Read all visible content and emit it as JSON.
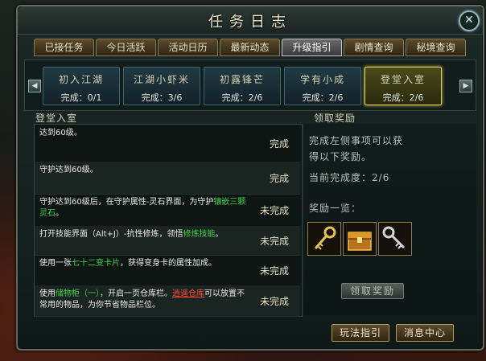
{
  "window": {
    "title": "任务日志",
    "close": "✕"
  },
  "tabs": [
    "已接任务",
    "今日活跃",
    "活动日历",
    "最新动态",
    "升级指引",
    "剧情查询",
    "秘境查询"
  ],
  "active_tab_index": 4,
  "stages": [
    {
      "name": "初入江湖",
      "progress": "完成：0/1"
    },
    {
      "name": "江湖小虾米",
      "progress": "完成：3/6"
    },
    {
      "name": "初露锋芒",
      "progress": "完成：2/6"
    },
    {
      "name": "学有小成",
      "progress": "完成：2/6"
    },
    {
      "name": "登堂入室",
      "progress": "完成：2/6"
    }
  ],
  "active_stage_index": 4,
  "nav": {
    "prev": "◀",
    "next": "▶"
  },
  "section": {
    "title": "登堂入室"
  },
  "tasks": [
    {
      "parts": [
        {
          "t": "达到60级。"
        }
      ],
      "status": "完成"
    },
    {
      "parts": [
        {
          "t": "守护达到60级。"
        }
      ],
      "status": "完成"
    },
    {
      "parts": [
        {
          "t": "守护达到60级后，在守护属性-灵石界面，为守护"
        },
        {
          "t": "镶嵌三颗灵石",
          "c": "g"
        },
        {
          "t": "。"
        }
      ],
      "status": "未完成"
    },
    {
      "parts": [
        {
          "t": "打开技能界面（Alt+J）-抗性修炼，领悟"
        },
        {
          "t": "修炼技能",
          "c": "g"
        },
        {
          "t": "。"
        }
      ],
      "status": "未完成"
    },
    {
      "parts": [
        {
          "t": "使用一张"
        },
        {
          "t": "七十二变卡片",
          "c": "g"
        },
        {
          "t": "，获得变身卡的属性加成。"
        }
      ],
      "status": "未完成"
    },
    {
      "parts": [
        {
          "t": "使用"
        },
        {
          "t": "储物柜（一）",
          "c": "g"
        },
        {
          "t": "，开启一页仓库栏。"
        },
        {
          "t": "逍遥仓库",
          "c": "r"
        },
        {
          "t": "可以放置不常用的物品，为你节省物品栏位。"
        }
      ],
      "status": "未完成"
    }
  ],
  "reward": {
    "title": "领取奖励",
    "desc_line1": "完成左侧事项可以获",
    "desc_line2": "得以下奖励。",
    "progress_label": "当前完成度：",
    "progress_value": "2/6",
    "list_label": "奖励一览：",
    "items": [
      "gold-key",
      "treasure-chest",
      "silver-key"
    ],
    "claim_button": "领取奖励"
  },
  "footer": {
    "guide_button": "玩法指引",
    "message_button": "消息中心"
  }
}
